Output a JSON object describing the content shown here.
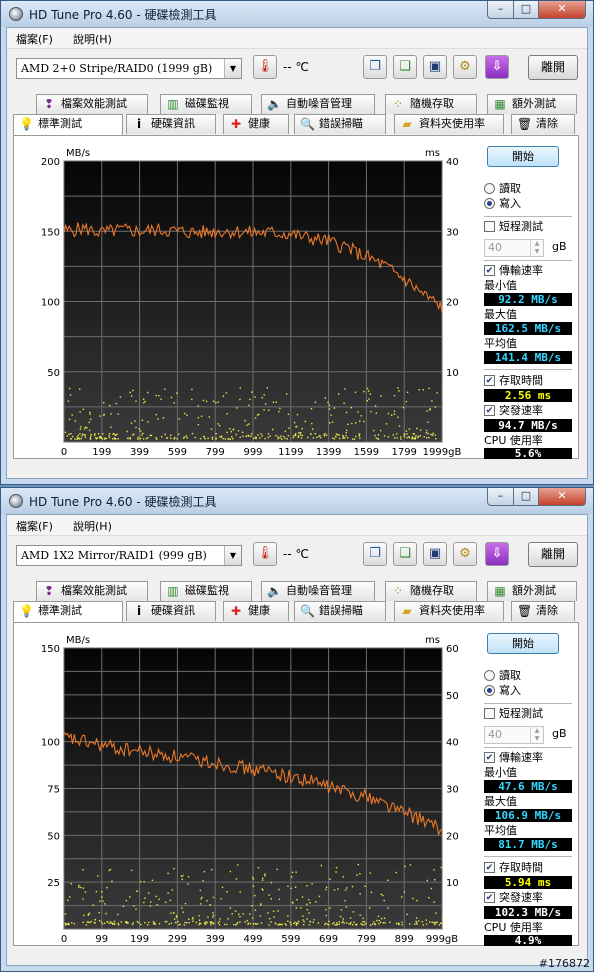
{
  "windows": [
    {
      "title": "HD Tune Pro 4.60 - 硬碟檢測工具",
      "window_buttons": {
        "minimize": "–",
        "maximize": "□",
        "close": "✕"
      },
      "menu": [
        "檔案(F)",
        "說明(H)"
      ],
      "drive": "AMD     2+0 Stripe/RAID0 (1999 gB)",
      "temperature": "-- ℃",
      "exit_label": "離開",
      "tabs_row1": [
        {
          "label": "檔案效能測試",
          "icon": "file-benchmark-icon"
        },
        {
          "label": "磁碟監視",
          "icon": "disk-monitor-icon"
        },
        {
          "label": "自動噪音管理",
          "icon": "speaker-icon"
        },
        {
          "label": "隨機存取",
          "icon": "random-access-icon"
        },
        {
          "label": "額外測試",
          "icon": "extra-tests-icon"
        }
      ],
      "tabs_row2": [
        {
          "label": "標準測試",
          "icon": "lightbulb-icon",
          "active": true
        },
        {
          "label": "硬碟資訊",
          "icon": "info-icon"
        },
        {
          "label": "健康",
          "icon": "health-cross-icon"
        },
        {
          "label": "錯誤掃瞄",
          "icon": "magnifier-icon"
        },
        {
          "label": "資料夾使用率",
          "icon": "folder-icon"
        },
        {
          "label": "清除",
          "icon": "trash-icon"
        }
      ],
      "side": {
        "start_label": "開始",
        "read_label": "讀取",
        "write_label": "寫入",
        "mode": "write",
        "short_test_label": "短程測試",
        "short_test_checked": false,
        "short_test_size": "40",
        "size_unit": "gB",
        "transfer_rate_label": "傳輸速率",
        "transfer_rate_checked": true,
        "min_label": "最小值",
        "min_value": "92.2 MB/s",
        "max_label": "最大值",
        "max_value": "162.5 MB/s",
        "avg_label": "平均值",
        "avg_value": "141.4 MB/s",
        "access_time_label": "存取時間",
        "access_time_checked": true,
        "access_time_value": "2.56 ms",
        "burst_rate_label": "突發速率",
        "burst_rate_checked": true,
        "burst_rate_value": "94.7 MB/s",
        "cpu_label": "CPU 使用率",
        "cpu_value": "5.6%"
      },
      "chart_data": {
        "type": "line",
        "y_left_unit": "MB/s",
        "y_right_unit": "ms",
        "ylim": [
          0,
          200
        ],
        "y2lim": [
          0,
          40
        ],
        "left_ticks": [
          "200",
          "150",
          "100",
          "50"
        ],
        "right_ticks": [
          "40",
          "30",
          "20",
          "10"
        ],
        "x_ticks": [
          "0",
          "199",
          "399",
          "599",
          "799",
          "999",
          "1199",
          "1399",
          "1599",
          "1799",
          "1999gB"
        ],
        "xlim": [
          0,
          1999
        ],
        "grid": true,
        "series": [
          {
            "values_x_gb": [
              0,
              100,
              200,
              300,
              400,
              500,
              600,
              700,
              800,
              900,
              1000,
              1100,
              1200,
              1300,
              1400,
              1450,
              1500,
              1540,
              1600,
              1700,
              1800,
              1900,
              1999
            ],
            "values_mbps": [
              150,
              152,
              149,
              151,
              150,
              151,
              150,
              149,
              150,
              150,
              149,
              149,
              148,
              145,
              143,
              140,
              139,
              135,
              132,
              125,
              116,
              105,
              96
            ],
            "color": "#e8782a"
          }
        ],
        "access_time_ms": {
          "color": "#e6e84a",
          "band_ms": [
            0.5,
            8.0
          ],
          "typical_ms": 2.56
        }
      }
    },
    {
      "title": "HD Tune Pro 4.60 - 硬碟檢測工具",
      "window_buttons": {
        "minimize": "–",
        "maximize": "□",
        "close": "✕"
      },
      "menu": [
        "檔案(F)",
        "說明(H)"
      ],
      "drive": "AMD     1X2 Mirror/RAID1 (999 gB)",
      "temperature": "-- ℃",
      "exit_label": "離開",
      "tabs_row1": [
        {
          "label": "檔案效能測試",
          "icon": "file-benchmark-icon"
        },
        {
          "label": "磁碟監視",
          "icon": "disk-monitor-icon"
        },
        {
          "label": "自動噪音管理",
          "icon": "speaker-icon"
        },
        {
          "label": "隨機存取",
          "icon": "random-access-icon"
        },
        {
          "label": "額外測試",
          "icon": "extra-tests-icon"
        }
      ],
      "tabs_row2": [
        {
          "label": "標準測試",
          "icon": "lightbulb-icon",
          "active": true
        },
        {
          "label": "硬碟資訊",
          "icon": "info-icon"
        },
        {
          "label": "健康",
          "icon": "health-cross-icon"
        },
        {
          "label": "錯誤掃瞄",
          "icon": "magnifier-icon"
        },
        {
          "label": "資料夾使用率",
          "icon": "folder-icon"
        },
        {
          "label": "清除",
          "icon": "trash-icon"
        }
      ],
      "side": {
        "start_label": "開始",
        "read_label": "讀取",
        "write_label": "寫入",
        "mode": "write",
        "short_test_label": "短程測試",
        "short_test_checked": false,
        "short_test_size": "40",
        "size_unit": "gB",
        "transfer_rate_label": "傳輸速率",
        "transfer_rate_checked": true,
        "min_label": "最小值",
        "min_value": "47.6 MB/s",
        "max_label": "最大值",
        "max_value": "106.9 MB/s",
        "avg_label": "平均值",
        "avg_value": "81.7 MB/s",
        "access_time_label": "存取時間",
        "access_time_checked": true,
        "access_time_value": "5.94 ms",
        "burst_rate_label": "突發速率",
        "burst_rate_checked": true,
        "burst_rate_value": "102.3 MB/s",
        "cpu_label": "CPU 使用率",
        "cpu_value": "4.9%"
      },
      "chart_data": {
        "type": "line",
        "y_left_unit": "MB/s",
        "y_right_unit": "ms",
        "ylim": [
          0,
          150
        ],
        "y2lim": [
          0,
          60
        ],
        "left_ticks": [
          "150",
          "100",
          "75",
          "50",
          "25"
        ],
        "right_ticks": [
          "60",
          "50",
          "40",
          "30",
          "20",
          "10"
        ],
        "x_ticks": [
          "0",
          "99",
          "199",
          "299",
          "399",
          "499",
          "599",
          "699",
          "799",
          "899",
          "999gB"
        ],
        "xlim": [
          0,
          999
        ],
        "grid": true,
        "series": [
          {
            "values_x_gb": [
              0,
              50,
              100,
              150,
              200,
              250,
              300,
              350,
              400,
              450,
              500,
              550,
              600,
              650,
              700,
              750,
              800,
              850,
              900,
              950,
              999
            ],
            "values_mbps": [
              102,
              100,
              98,
              96,
              95,
              93,
              92,
              90,
              89,
              87,
              85,
              84,
              81,
              79,
              76,
              73,
              71,
              67,
              62,
              58,
              52
            ],
            "color": "#e8782a"
          }
        ],
        "access_time_ms": {
          "color": "#e6e84a",
          "band_ms": [
            1.0,
            14.0
          ],
          "typical_ms": 5.94
        }
      }
    }
  ],
  "watermark": "#176872",
  "colors": {
    "chart_bg": "#141414",
    "grid": "#6e6e6e",
    "stat_text": "#36d7ff",
    "access_text": "#ffff00",
    "cpu_text": "#ffffff"
  }
}
